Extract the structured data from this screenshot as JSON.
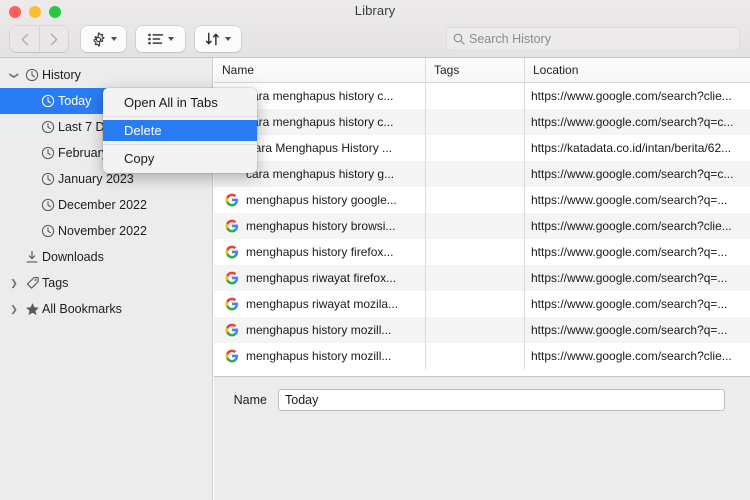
{
  "window": {
    "title": "Library",
    "traffic_lights": [
      {
        "name": "close",
        "color": "#ff5f57"
      },
      {
        "name": "minimize",
        "color": "#febc2e"
      },
      {
        "name": "zoom",
        "color": "#28c840"
      }
    ]
  },
  "toolbar": {
    "back_label": "‹",
    "forward_label": "›",
    "gear_name": "gear-icon",
    "list_name": "list-icon",
    "sort_name": "sort-icon",
    "search": {
      "placeholder": "Search History",
      "value": ""
    }
  },
  "sidebar": {
    "items": [
      {
        "label": "History",
        "icon": "clock-icon",
        "level": 1,
        "disclosure": "open",
        "selected": false
      },
      {
        "label": "Today",
        "icon": "clock-icon",
        "level": 2,
        "disclosure": "none",
        "selected": true
      },
      {
        "label": "Last 7 Days",
        "icon": "clock-icon",
        "level": 2,
        "disclosure": "none",
        "selected": false
      },
      {
        "label": "February 2023",
        "icon": "clock-icon",
        "level": 2,
        "disclosure": "none",
        "selected": false
      },
      {
        "label": "January 2023",
        "icon": "clock-icon",
        "level": 2,
        "disclosure": "none",
        "selected": false
      },
      {
        "label": "December 2022",
        "icon": "clock-icon",
        "level": 2,
        "disclosure": "none",
        "selected": false
      },
      {
        "label": "November 2022",
        "icon": "clock-icon",
        "level": 2,
        "disclosure": "none",
        "selected": false
      },
      {
        "label": "Downloads",
        "icon": "download-icon",
        "level": 1,
        "disclosure": "none",
        "selected": false
      },
      {
        "label": "Tags",
        "icon": "tag-icon",
        "level": 1,
        "disclosure": "closed",
        "selected": false
      },
      {
        "label": "All Bookmarks",
        "icon": "star-icon",
        "level": 1,
        "disclosure": "closed",
        "selected": false
      }
    ]
  },
  "context_menu": {
    "items": [
      {
        "label": "Open All in Tabs",
        "highlighted": false,
        "separator_after": true
      },
      {
        "label": "Delete",
        "highlighted": true,
        "separator_after": true
      },
      {
        "label": "Copy",
        "highlighted": false,
        "separator_after": false
      }
    ]
  },
  "table": {
    "columns": [
      "Name",
      "Tags",
      "Location"
    ],
    "rows": [
      {
        "favicon": "none",
        "name": "cara menghapus history c...",
        "tags": "",
        "location": "https://www.google.com/search?clie..."
      },
      {
        "favicon": "none",
        "name": "cara menghapus history c...",
        "tags": "",
        "location": "https://www.google.com/search?q=c..."
      },
      {
        "favicon": "none",
        "name": "Cara Menghapus History ...",
        "tags": "",
        "location": "https://katadata.co.id/intan/berita/62..."
      },
      {
        "favicon": "none",
        "name": "cara menghapus history g...",
        "tags": "",
        "location": "https://www.google.com/search?q=c..."
      },
      {
        "favicon": "google",
        "name": "menghapus history google...",
        "tags": "",
        "location": "https://www.google.com/search?q=..."
      },
      {
        "favicon": "google",
        "name": "menghapus history browsi...",
        "tags": "",
        "location": "https://www.google.com/search?clie..."
      },
      {
        "favicon": "google",
        "name": "menghapus history firefox...",
        "tags": "",
        "location": "https://www.google.com/search?q=..."
      },
      {
        "favicon": "google",
        "name": "menghapus riwayat firefox...",
        "tags": "",
        "location": "https://www.google.com/search?q=..."
      },
      {
        "favicon": "google",
        "name": "menghapus riwayat mozila...",
        "tags": "",
        "location": "https://www.google.com/search?q=..."
      },
      {
        "favicon": "google",
        "name": "menghapus history mozill...",
        "tags": "",
        "location": "https://www.google.com/search?q=..."
      },
      {
        "favicon": "google",
        "name": "menghapus history mozill...",
        "tags": "",
        "location": "https://www.google.com/search?clie..."
      }
    ]
  },
  "detail": {
    "name_label": "Name",
    "name_value": "Today"
  },
  "colors": {
    "accent": "#2a7cf5",
    "sidebar_bg": "#ececec",
    "row_alt": "#f4f4f4",
    "titlebar": "#e8e6e6"
  }
}
